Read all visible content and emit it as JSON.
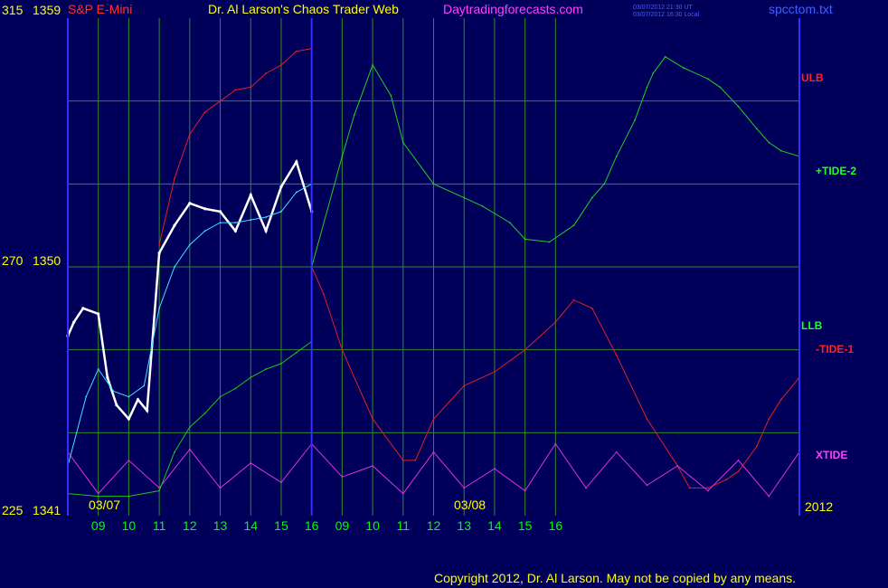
{
  "header": {
    "symbol": "S&P E-Mini",
    "title": "Dr. Al Larson's Chaos Trader Web",
    "site": "Daytradingforecasts.com",
    "timestamp_ut": "03/07/2012 21:30 UT",
    "timestamp_local": "03/07/2012 16:30 Local",
    "file": "spcctom.txt"
  },
  "footer": {
    "copyright": "Copyright 2012, Dr. Al Larson. May not be copied by any means."
  },
  "colors": {
    "background": "#00005a",
    "grid": "#2e8b2e",
    "frame": "#3030ff",
    "price_up": "#ffffff",
    "price_down": "#ff0000",
    "ma_yellow": "#ffff40",
    "ma_cyan": "#40e0ff",
    "ulb": "#e02020",
    "llb": "#20c020",
    "tide_plus": "#20d020",
    "tide_minus": "#e02020",
    "xtide": "#e030e0",
    "label_yellow": "#ffff00",
    "label_green": "#00ff00"
  },
  "chart_data": {
    "type": "line",
    "title": "S&P E-Mini",
    "grid": true,
    "y_axis": {
      "ticks": [
        {
          "left": "315",
          "price": "1359",
          "value": 1359
        },
        {
          "left": "270",
          "price": "1350",
          "value": 1350
        },
        {
          "left": "225",
          "price": "1341",
          "value": 1341
        }
      ],
      "range": [
        1341,
        1359
      ]
    },
    "x_axis": {
      "ticks": [
        "09",
        "10",
        "11",
        "12",
        "13",
        "14",
        "15",
        "16",
        "09",
        "10",
        "11",
        "12",
        "13",
        "14",
        "15",
        "16"
      ],
      "date_labels": [
        "03/07",
        "03/08"
      ],
      "year_label": "2012",
      "range": [
        8.0,
        32.0
      ],
      "divider": 16.0
    },
    "series_labels": [
      {
        "name": "ULB",
        "color": "#ff2020"
      },
      {
        "name": "+TIDE-2",
        "color": "#20ff20"
      },
      {
        "name": "LLB",
        "color": "#20ff20"
      },
      {
        "name": "-TIDE-1",
        "color": "#ff2020"
      },
      {
        "name": "XTIDE",
        "color": "#ff40ff"
      }
    ],
    "series": [
      {
        "name": "ULB",
        "x": [
          11,
          11.5,
          12,
          12.5,
          13,
          13.5,
          14,
          14.5,
          15,
          15.5,
          16
        ],
        "y": [
          1350.8,
          1353.2,
          1354.8,
          1355.6,
          1356.0,
          1356.4,
          1356.5,
          1357.0,
          1357.3,
          1357.8,
          1357.9
        ]
      },
      {
        "name": "+TIDE-2",
        "x": [
          16,
          17,
          17.4,
          18,
          18.6,
          19,
          20,
          21,
          21.6,
          22.5,
          23,
          23.8,
          24.6,
          25.2,
          25.6,
          26,
          26.6,
          27,
          27.2,
          27.6,
          28.2,
          29,
          29.4,
          30,
          30.6,
          31,
          31.4,
          32
        ],
        "y": [
          1350.0,
          1354.0,
          1355.5,
          1357.3,
          1356.2,
          1354.5,
          1353.0,
          1352.5,
          1352.2,
          1351.6,
          1351.0,
          1350.9,
          1351.5,
          1352.5,
          1353.0,
          1354.0,
          1355.3,
          1356.5,
          1357.0,
          1357.6,
          1357.2,
          1356.8,
          1356.5,
          1355.8,
          1355.0,
          1354.5,
          1354.2,
          1354.0
        ]
      },
      {
        "name": "-TIDE-1",
        "x": [
          16,
          16.4,
          17,
          18,
          19,
          19.4,
          20,
          21,
          22,
          23,
          24,
          24.6,
          25.2,
          26,
          27,
          28,
          28.4,
          29,
          29.6,
          30,
          30.6,
          31,
          31.4,
          32
        ],
        "y": [
          1350.0,
          1349.0,
          1347.0,
          1344.5,
          1343.0,
          1343.0,
          1344.5,
          1345.7,
          1346.2,
          1347.0,
          1348.0,
          1348.8,
          1348.5,
          1346.8,
          1344.5,
          1342.8,
          1342.0,
          1342.0,
          1342.3,
          1342.6,
          1343.5,
          1344.5,
          1345.2,
          1346.0
        ]
      },
      {
        "name": "XTIDE",
        "x": [
          8,
          9,
          10,
          11,
          12,
          13,
          14,
          15,
          16,
          17,
          18,
          19,
          20,
          21,
          22,
          23,
          24,
          25,
          26,
          27,
          28,
          29,
          30,
          31,
          32
        ],
        "y": [
          1343.3,
          1341.8,
          1343.0,
          1342.0,
          1343.4,
          1342.0,
          1342.9,
          1342.2,
          1343.6,
          1342.4,
          1342.8,
          1341.8,
          1343.3,
          1342.0,
          1342.7,
          1341.9,
          1343.6,
          1342.0,
          1343.3,
          1342.1,
          1342.8,
          1341.9,
          1343.0,
          1341.7,
          1343.3
        ]
      },
      {
        "name": "Price",
        "x": [
          8,
          8.2,
          8.5,
          9,
          9.3,
          9.6,
          10,
          10.3,
          10.6,
          11,
          11.5,
          12,
          12.5,
          13,
          13.5,
          14,
          14.5,
          15,
          15.5,
          16
        ],
        "y": [
          1347.5,
          1348.0,
          1348.5,
          1348.3,
          1346.0,
          1345.0,
          1344.5,
          1345.2,
          1344.8,
          1350.5,
          1351.5,
          1352.3,
          1352.1,
          1352.0,
          1351.3,
          1352.6,
          1351.3,
          1352.9,
          1353.8,
          1352.0
        ]
      },
      {
        "name": "MA",
        "x": [
          8,
          8.6,
          9,
          9.5,
          10,
          10.5,
          11,
          11.5,
          12,
          12.5,
          13,
          13.5,
          14,
          14.5,
          15,
          15.5,
          16
        ],
        "y": [
          1342.8,
          1345.3,
          1346.3,
          1345.5,
          1345.3,
          1345.7,
          1348.5,
          1350.0,
          1350.8,
          1351.3,
          1351.6,
          1351.6,
          1351.7,
          1351.8,
          1352.0,
          1352.7,
          1353.0
        ]
      },
      {
        "name": "LLB",
        "x": [
          8,
          9,
          10,
          11,
          11.5,
          12,
          12.5,
          13,
          13.5,
          14,
          14.5,
          15,
          15.5,
          16
        ],
        "y": [
          1341.8,
          1341.7,
          1341.7,
          1341.9,
          1343.3,
          1344.2,
          1344.7,
          1345.3,
          1345.6,
          1346.0,
          1346.3,
          1346.5,
          1346.9,
          1347.3
        ]
      }
    ]
  }
}
